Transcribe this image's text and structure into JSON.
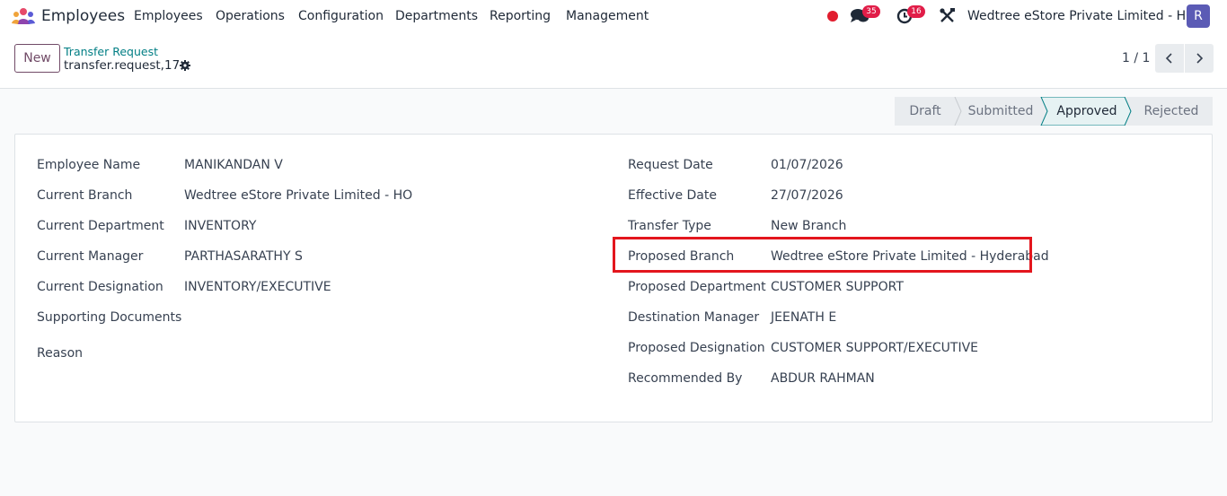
{
  "navbar": {
    "app_name": "Employees",
    "menu": [
      "Employees",
      "Operations",
      "Configuration",
      "Departments",
      "Reporting",
      "Management"
    ],
    "messages_count": "35",
    "activities_count": "16",
    "company": "Wedtree eStore Private Limited - HO",
    "user_initial": "R",
    "colors": {
      "recording_dot": "#e11d2e",
      "badge": "#e11d48",
      "avatar": "#5b5bb5"
    }
  },
  "control_panel": {
    "new_label": "New",
    "breadcrumb_parent": "Transfer Request",
    "breadcrumb_current": "transfer.request,17",
    "pager": "1 / 1"
  },
  "statusbar": {
    "stages": [
      "Draft",
      "Submitted",
      "Approved",
      "Rejected"
    ],
    "active": "Approved"
  },
  "form": {
    "left": [
      {
        "label": "Employee Name",
        "value": "MANIKANDAN V"
      },
      {
        "label": "Current Branch",
        "value": "Wedtree eStore Private Limited - HO"
      },
      {
        "label": "Current Department",
        "value": "INVENTORY"
      },
      {
        "label": "Current Manager",
        "value": "PARTHASARATHY S"
      },
      {
        "label": "Current Designation",
        "value": "INVENTORY/EXECUTIVE"
      },
      {
        "label": "Supporting Documents",
        "value": ""
      },
      {
        "label": "Reason",
        "value": ""
      }
    ],
    "right": [
      {
        "label": "Request Date",
        "value": "01/07/2026"
      },
      {
        "label": "Effective Date",
        "value": "27/07/2026"
      },
      {
        "label": "Transfer Type",
        "value": "New Branch"
      },
      {
        "label": "Proposed Branch",
        "value": "Wedtree eStore Private Limited - Hyderabad"
      },
      {
        "label": "Proposed Department",
        "value": "CUSTOMER SUPPORT"
      },
      {
        "label": "Destination Manager",
        "value": "JEENATH E"
      },
      {
        "label": "Proposed Designation",
        "value": "CUSTOMER SUPPORT/EXECUTIVE"
      },
      {
        "label": "Recommended By",
        "value": "ABDUR RAHMAN"
      }
    ],
    "highlight_color": "#e3161d"
  }
}
